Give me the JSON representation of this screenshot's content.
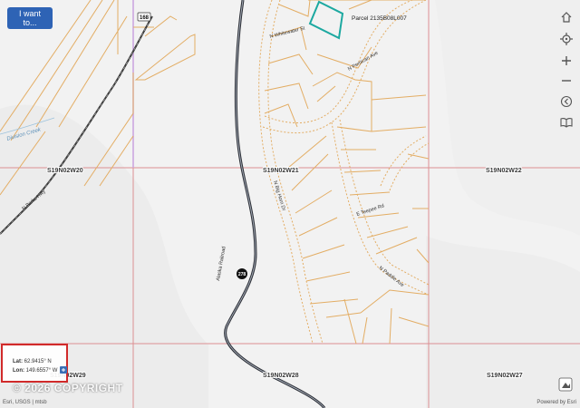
{
  "toolbar": {
    "i_want_to_label": "I want to..."
  },
  "map": {
    "parcel_label": "Parcel 2135B08L007",
    "roads": {
      "n_whitewater_st": "N Whitewater St",
      "n_pemican_ave": "N Pemican Ave",
      "n_big_horn_dr": "N Big Horn Dr",
      "e_teepee_rd": "E Teepee Rd",
      "n_paddle_ave": "N Paddle Ave",
      "n_parks_hwy": "N Parks Hwy",
      "alaska_railroad": "Alaska Railroad"
    },
    "water": {
      "division_creek": "Division Creek"
    },
    "route_shields": {
      "route_168": "168",
      "route_278": "278"
    },
    "sections": {
      "s19n02w20": "S19N02W20",
      "s19n02w21": "S19N02W21",
      "s19n02w22": "S19N02W22",
      "s19n02w29": "S19N02W29",
      "s19n02w28": "S19N02W28",
      "s19n02w27": "S19N02W27"
    },
    "colors": {
      "parcel_line": "#e3ad64",
      "section_line": "#dc8f92",
      "selection": "#1ba8a0",
      "railroad": "#444a55"
    }
  },
  "coordinates": {
    "lat_label": "Lat:",
    "lat_value": "62.9415° N",
    "lon_label": "Lon:",
    "lon_value": "149.6557° W"
  },
  "watermark": "© 2026 COPYRIGHT",
  "footer": {
    "attribution": "Esri, USGS | mtsb",
    "powered_by": "Powered by Esri"
  },
  "controls": [
    "home-icon",
    "locate-icon",
    "zoom-in-icon",
    "zoom-out-icon",
    "back-icon",
    "book-icon"
  ]
}
